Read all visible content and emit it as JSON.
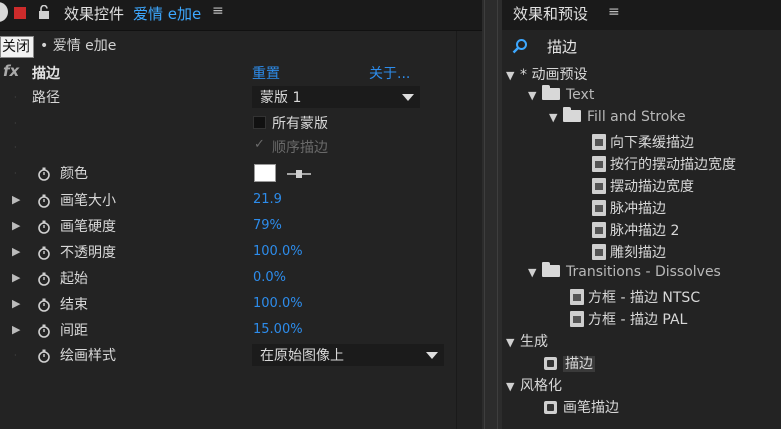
{
  "effect_controls": {
    "tab_title": "效果控件",
    "tab_layer": "爱情 e加e",
    "menu_glyph": "≡",
    "tooltip": "关闭",
    "layer_label": "• 爱情 e加e",
    "effect": {
      "fx": "fx",
      "name": "描边",
      "reset": "重置",
      "about": "关于..."
    },
    "properties": {
      "path": {
        "label": "路径",
        "value": "蒙版 1"
      },
      "all_masks": {
        "label": "所有蒙版",
        "checked": false
      },
      "stroke_sequentially": {
        "label": "顺序描边",
        "checked": true
      },
      "color": {
        "label": "颜色",
        "value": "#ffffff"
      },
      "brush_size": {
        "label": "画笔大小",
        "value": "21.9"
      },
      "brush_hardness": {
        "label": "画笔硬度",
        "value": "79%"
      },
      "opacity": {
        "label": "不透明度",
        "value": "100.0%"
      },
      "start": {
        "label": "起始",
        "value": "0.0%"
      },
      "end": {
        "label": "结束",
        "value": "100.0%"
      },
      "spacing": {
        "label": "间距",
        "value": "15.00%"
      },
      "paint_style": {
        "label": "绘画样式",
        "value": "在原始图像上"
      }
    }
  },
  "effects_presets": {
    "tab_title": "效果和预设",
    "menu_glyph": "≡",
    "search_value": "描边",
    "tree": {
      "animation_presets": "* 动画预设",
      "text": "Text",
      "fill_stroke": "Fill and Stroke",
      "fs_items": [
        "向下柔缓描边",
        "按行的摆动描边宽度",
        "摆动描边宽度",
        "脉冲描边",
        "脉冲描边 2",
        "雕刻描边"
      ],
      "transitions": "Transitions - Dissolves",
      "tr_items": [
        "方框 - 描边 NTSC",
        "方框 - 描边 PAL"
      ],
      "generate": "生成",
      "generate_item": "描边",
      "stylize": "风格化",
      "stylize_item": "画笔描边"
    }
  }
}
